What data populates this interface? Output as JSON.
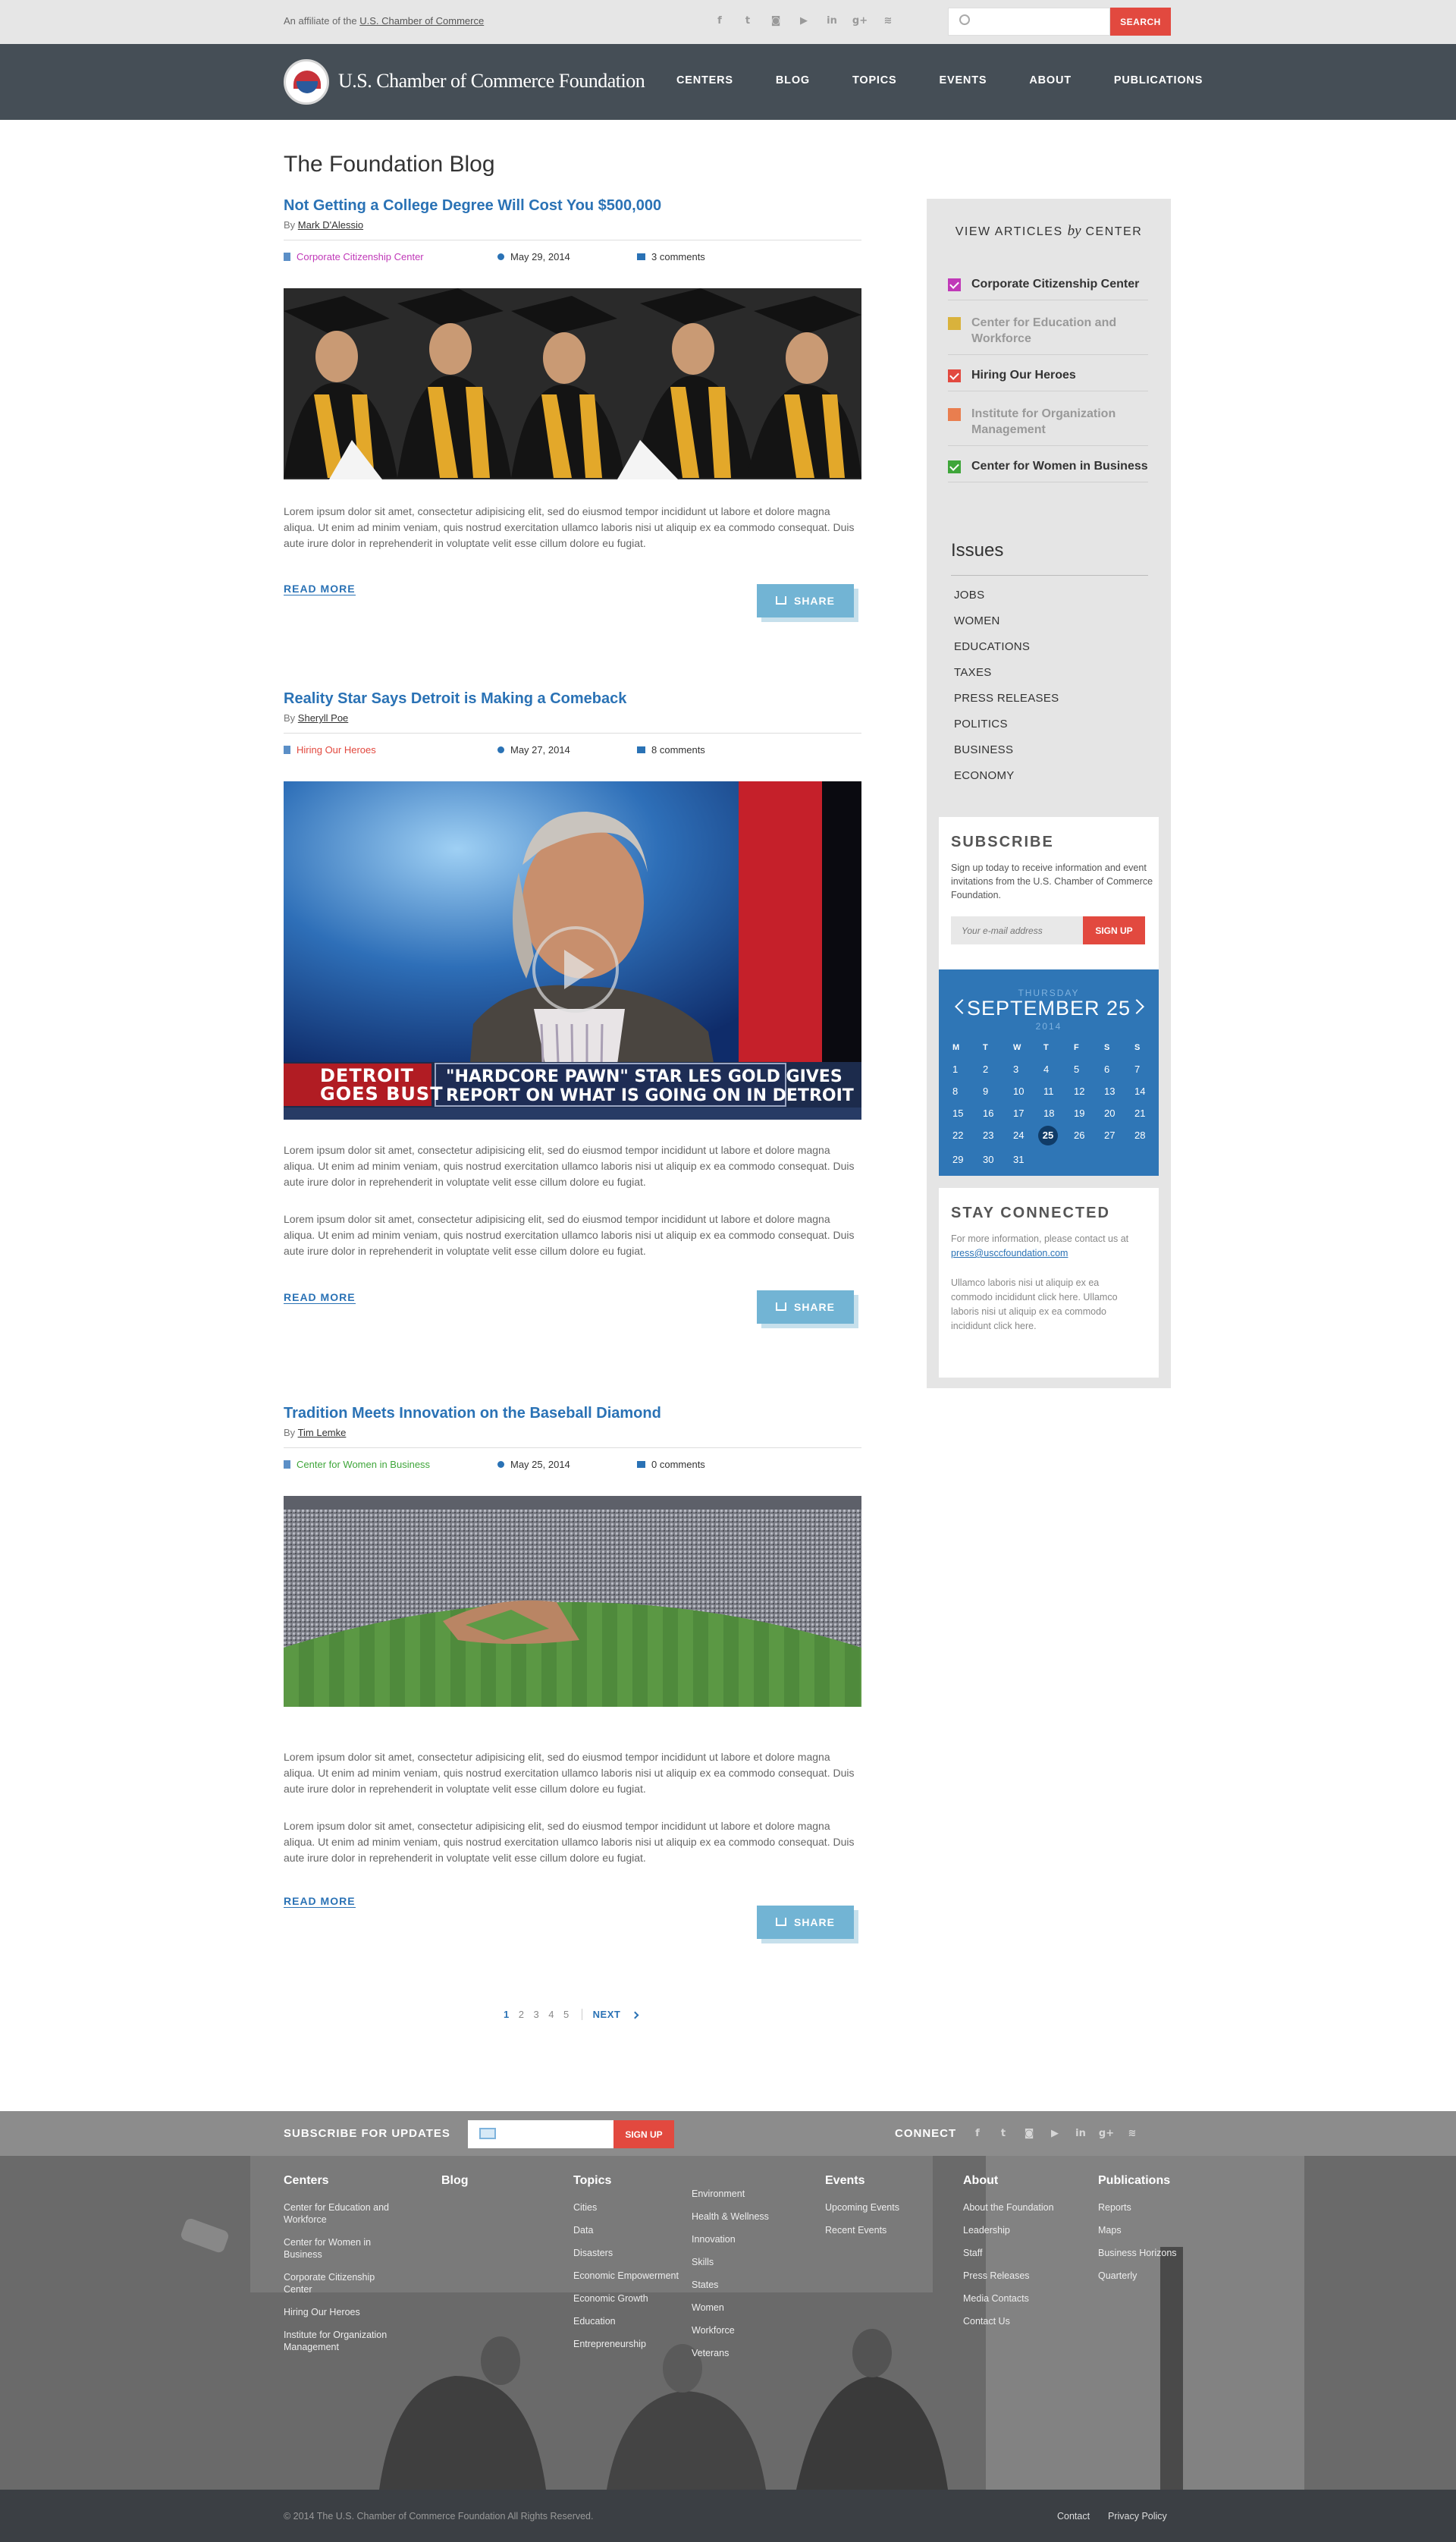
{
  "topbar": {
    "affiliate_prefix": "An affiliate of the ",
    "affiliate_link": "U.S. Chamber of Commerce",
    "search_placeholder": "",
    "search_button": "SEARCH",
    "social": [
      {
        "icon": "facebook-icon",
        "glyph": "f"
      },
      {
        "icon": "twitter-icon",
        "glyph": "t"
      },
      {
        "icon": "instagram-icon",
        "glyph": "◙"
      },
      {
        "icon": "youtube-icon",
        "glyph": "▶"
      },
      {
        "icon": "linkedin-icon",
        "glyph": "in"
      },
      {
        "icon": "googleplus-icon",
        "glyph": "g+"
      },
      {
        "icon": "rss-icon",
        "glyph": "≋"
      }
    ]
  },
  "nav": {
    "logo_text": "U.S. Chamber of Commerce Foundation",
    "items": [
      "CENTERS",
      "BLOG",
      "TOPICS",
      "EVENTS",
      "ABOUT",
      "PUBLICATIONS"
    ]
  },
  "page_title": "The Foundation Blog",
  "posts": [
    {
      "title": "Not Getting a College Degree Will Cost You $500,000",
      "by": "By ",
      "author": "Mark D'Alessio",
      "category": "Corporate Citizenship Center",
      "category_color": "#c039b8",
      "date": "May 29, 2014",
      "comments": "3 comments",
      "paragraphs": [
        "Lorem ipsum dolor sit amet, consectetur adipisicing elit, sed do eiusmod tempor incididunt ut labore et dolore magna aliqua. Ut enim ad minim veniam, quis nostrud exercitation ullamco laboris nisi ut aliquip ex ea commodo consequat. Duis aute irure dolor in reprehenderit in voluptate velit esse cillum dolore eu fugiat."
      ],
      "read_more": "READ MORE",
      "share": "SHARE"
    },
    {
      "title": "Reality Star Says Detroit is Making a Comeback",
      "by": "By ",
      "author": "Sheryll Poe",
      "category": "Hiring Our Heroes",
      "category_color": "#e2493f",
      "date": "May 27, 2014",
      "comments": "8 comments",
      "video_badge_1": "DETROIT",
      "video_badge_2": "GOES BUST",
      "video_caption_1": "\"HARDCORE PAWN\" STAR LES GOLD GIVES",
      "video_caption_2": "REPORT ON WHAT IS GOING ON IN DETROIT",
      "paragraphs": [
        "Lorem ipsum dolor sit amet, consectetur adipisicing elit, sed do eiusmod tempor incididunt ut labore et dolore magna aliqua. Ut enim ad minim veniam, quis nostrud exercitation ullamco laboris nisi ut aliquip ex ea commodo consequat. Duis aute irure dolor in reprehenderit in voluptate velit esse cillum dolore eu fugiat.",
        "Lorem ipsum dolor sit amet, consectetur adipisicing elit, sed do eiusmod tempor incididunt ut labore et dolore magna aliqua. Ut enim ad minim veniam, quis nostrud exercitation ullamco laboris nisi ut aliquip ex ea commodo consequat. Duis aute irure dolor in reprehenderit in voluptate velit esse cillum dolore eu fugiat."
      ],
      "read_more": "READ MORE",
      "share": "SHARE"
    },
    {
      "title": "Tradition Meets Innovation on the Baseball Diamond",
      "by": "By ",
      "author": "Tim Lemke",
      "category": "Center for Women in Business",
      "category_color": "#3fa63a",
      "date": "May 25, 2014",
      "comments": "0 comments",
      "paragraphs": [
        "Lorem ipsum dolor sit amet, consectetur adipisicing elit, sed do eiusmod tempor incididunt ut labore et dolore magna aliqua. Ut enim ad minim veniam, quis nostrud exercitation ullamco laboris nisi ut aliquip ex ea commodo consequat. Duis aute irure dolor in reprehenderit in voluptate velit esse cillum dolore eu fugiat.",
        "Lorem ipsum dolor sit amet, consectetur adipisicing elit, sed do eiusmod tempor incididunt ut labore et dolore magna aliqua. Ut enim ad minim veniam, quis nostrud exercitation ullamco laboris nisi ut aliquip ex ea commodo consequat. Duis aute irure dolor in reprehenderit in voluptate velit esse cillum dolore eu fugiat."
      ],
      "read_more": "READ MORE",
      "share": "SHARE"
    }
  ],
  "sidebar": {
    "view_articles_1": "VIEW ARTICLES",
    "view_articles_by": "by",
    "view_articles_2": "CENTER",
    "centers": [
      {
        "label": "Corporate Citizenship Center",
        "color": "#c039b8",
        "checked": true,
        "active": true
      },
      {
        "label": "Center for Education and Workforce",
        "color": "#d9b23c",
        "checked": false,
        "active": false
      },
      {
        "label": "Hiring Our Heroes",
        "color": "#e2493f",
        "checked": true,
        "active": true
      },
      {
        "label": "Institute for Organization Management",
        "color": "#e97e4f",
        "checked": false,
        "active": false
      },
      {
        "label": "Center for Women in Business",
        "color": "#3fa63a",
        "checked": true,
        "active": true
      }
    ],
    "issues_title": "Issues",
    "issues": [
      "JOBS",
      "WOMEN",
      "EDUCATIONS",
      "TAXES",
      "PRESS RELEASES",
      "POLITICS",
      "BUSINESS",
      "ECONOMY"
    ],
    "subscribe": {
      "title": "SUBSCRIBE",
      "text": "Sign up today to receive information and event invitations from the U.S. Chamber of Commerce Foundation.",
      "placeholder": "Your e-mail address",
      "button": "SIGN UP"
    },
    "calendar": {
      "weekday": "THURSDAY",
      "month_day": "SEPTEMBER 25",
      "year": "2014",
      "headers": [
        "M",
        "T",
        "W",
        "T",
        "F",
        "S",
        "S"
      ],
      "days": [
        "1",
        "2",
        "3",
        "4",
        "5",
        "6",
        "7",
        "8",
        "9",
        "10",
        "11",
        "12",
        "13",
        "14",
        "15",
        "16",
        "17",
        "18",
        "19",
        "20",
        "21",
        "22",
        "23",
        "24",
        "25",
        "26",
        "27",
        "28",
        "29",
        "30",
        "31"
      ],
      "today": "25"
    },
    "stay": {
      "title": "STAY CONNECTED",
      "text1": "For more information, please contact us at ",
      "email": "press@usccfoundation.com",
      "text2": "Ullamco laboris nisi ut aliquip ex ea commodo incididunt click here. Ullamco laboris nisi ut aliquip ex ea commodo incididunt click here."
    }
  },
  "pagination": {
    "pages": [
      "1",
      "2",
      "3",
      "4",
      "5"
    ],
    "next": "NEXT"
  },
  "footer": {
    "subscribe_label": "SUBSCRIBE FOR UPDATES",
    "signup": "SIGN UP",
    "connect": "CONNECT",
    "columns": [
      {
        "title": "Centers",
        "items": [
          "Center for Education and Workforce",
          "Center for Women in Business",
          "Corporate Citizenship Center",
          "Hiring Our Heroes",
          "Institute for Organization Management"
        ]
      },
      {
        "title": "Blog",
        "items": []
      },
      {
        "title": "Topics",
        "items": [
          "Cities",
          "Data",
          "Disasters",
          "Economic Empowerment",
          "Economic Growth",
          "Education",
          "Entrepreneurship"
        ]
      },
      {
        "title": "",
        "items": [
          "Environment",
          "Health & Wellness",
          "Innovation",
          "Skills",
          "States",
          "Women",
          "Workforce",
          "Veterans"
        ]
      },
      {
        "title": "Events",
        "items": [
          "Upcoming Events",
          "Recent Events"
        ]
      },
      {
        "title": "About",
        "items": [
          "About the Foundation",
          "Leadership",
          "Staff",
          "Press Releases",
          "Media Contacts",
          "Contact Us"
        ]
      },
      {
        "title": "Publications",
        "items": [
          "Reports",
          "Maps",
          "Business Horizons",
          "Quarterly"
        ]
      }
    ],
    "copyright": "© 2014 The U.S. Chamber of Commerce Foundation All Rights Reserved.",
    "contact": "Contact",
    "privacy": "Privacy Policy"
  }
}
